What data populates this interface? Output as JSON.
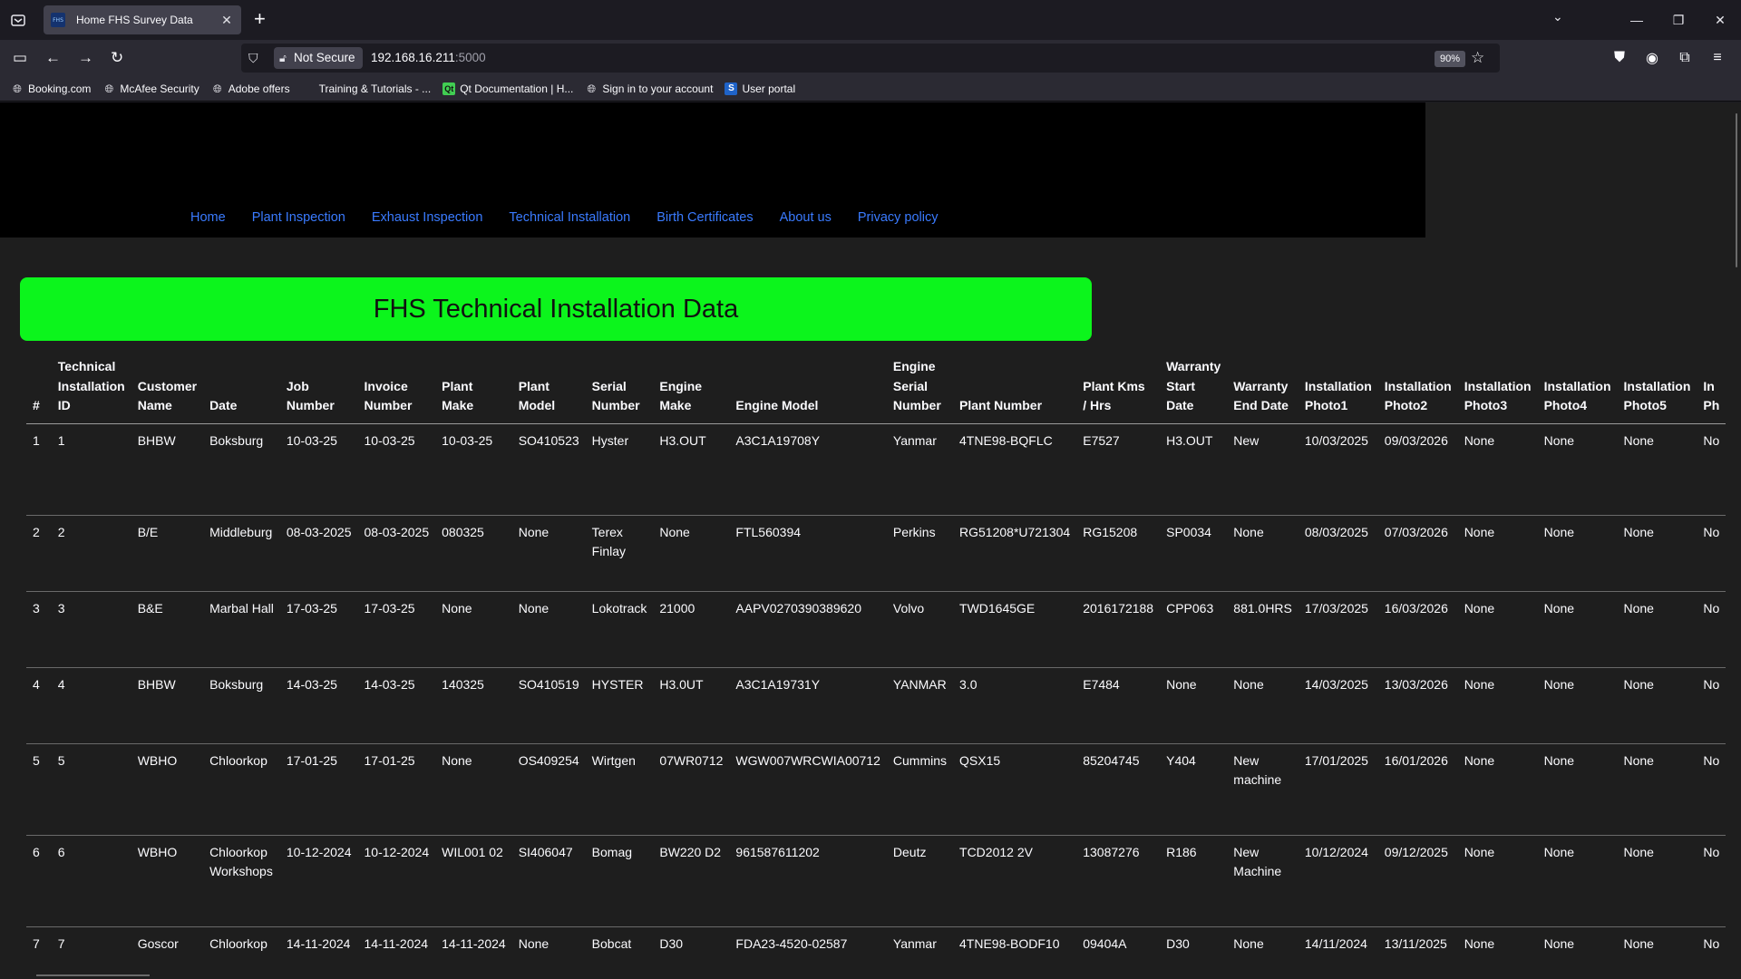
{
  "browser": {
    "tab_title": "Home FHS Survey Data",
    "favicon_text": "FHS",
    "security_label": "Not Secure",
    "url_host": "192.168.16.211",
    "url_port": ":5000",
    "zoom": "90%",
    "bookmarks": [
      {
        "label": "Booking.com",
        "icon": "globe-icon"
      },
      {
        "label": "McAfee Security",
        "icon": "globe-icon"
      },
      {
        "label": "Adobe offers",
        "icon": "globe-icon"
      },
      {
        "label": "Training & Tutorials - ...",
        "icon": "blank-icon"
      },
      {
        "label": "Qt Documentation | H...",
        "icon": "qt-icon"
      },
      {
        "label": "Sign in to your account",
        "icon": "globe-icon"
      },
      {
        "label": "User portal",
        "icon": "s-icon"
      }
    ]
  },
  "site": {
    "nav": [
      "Home",
      "Plant Inspection",
      "Exhaust Inspection",
      "Technical Installation",
      "Birth Certificates",
      "About us",
      "Privacy policy"
    ],
    "banner_title": "FHS Technical Installation Data"
  },
  "table": {
    "headers": [
      [
        "#"
      ],
      [
        "Technical",
        "Installation",
        "ID"
      ],
      [
        "Customer",
        "Name"
      ],
      [
        "Date"
      ],
      [
        "Job",
        "Number"
      ],
      [
        "Invoice",
        "Number"
      ],
      [
        "Plant",
        "Make"
      ],
      [
        "Plant",
        "Model"
      ],
      [
        "Serial",
        "Number"
      ],
      [
        "Engine",
        "Make"
      ],
      [
        "Engine Model"
      ],
      [
        "Engine",
        "Serial",
        "Number"
      ],
      [
        "Plant Number"
      ],
      [
        "Plant Kms",
        "/ Hrs"
      ],
      [
        "Warranty",
        "Start",
        "Date"
      ],
      [
        "Warranty",
        "End Date"
      ],
      [
        "Installation",
        "Photo1"
      ],
      [
        "Installation",
        "Photo2"
      ],
      [
        "Installation",
        "Photo3"
      ],
      [
        "Installation",
        "Photo4"
      ],
      [
        "Installation",
        "Photo5"
      ],
      [
        "In",
        "Ph"
      ]
    ],
    "rows": [
      [
        [
          "1"
        ],
        [
          "1"
        ],
        [
          "BHBW"
        ],
        [
          "Boksburg"
        ],
        [
          "10-03-25"
        ],
        [
          "10-03-25"
        ],
        [
          "10-03-25"
        ],
        [
          "SO410523"
        ],
        [
          "Hyster"
        ],
        [
          "H3.OUT"
        ],
        [
          "A3C1A19708Y"
        ],
        [
          "Yanmar"
        ],
        [
          "4TNE98-BQFLC"
        ],
        [
          "E7527"
        ],
        [
          "H3.OUT"
        ],
        [
          "New"
        ],
        [
          "10/03/2025"
        ],
        [
          "09/03/2026"
        ],
        [
          "None"
        ],
        [
          "None"
        ],
        [
          "None"
        ],
        [
          "No"
        ]
      ],
      [
        [
          "2"
        ],
        [
          "2"
        ],
        [
          "B/E"
        ],
        [
          "Middleburg"
        ],
        [
          "08-03-2025"
        ],
        [
          "08-03-2025"
        ],
        [
          "080325"
        ],
        [
          "None"
        ],
        [
          "Terex",
          "Finlay"
        ],
        [
          "None"
        ],
        [
          "FTL560394"
        ],
        [
          "Perkins"
        ],
        [
          "RG51208*U721304"
        ],
        [
          "RG15208"
        ],
        [
          "SP0034"
        ],
        [
          "None"
        ],
        [
          "08/03/2025"
        ],
        [
          "07/03/2026"
        ],
        [
          "None"
        ],
        [
          "None"
        ],
        [
          "None"
        ],
        [
          "No"
        ]
      ],
      [
        [
          "3"
        ],
        [
          "3"
        ],
        [
          "B&E"
        ],
        [
          "Marbal Hall"
        ],
        [
          "17-03-25"
        ],
        [
          "17-03-25"
        ],
        [
          "None"
        ],
        [
          "None"
        ],
        [
          "Lokotrack"
        ],
        [
          "21000"
        ],
        [
          "AAPV0270390389620"
        ],
        [
          "Volvo"
        ],
        [
          "TWD1645GE"
        ],
        [
          "2016172188"
        ],
        [
          "CPP063"
        ],
        [
          "881.0HRS"
        ],
        [
          "17/03/2025"
        ],
        [
          "16/03/2026"
        ],
        [
          "None"
        ],
        [
          "None"
        ],
        [
          "None"
        ],
        [
          "No"
        ]
      ],
      [
        [
          "4"
        ],
        [
          "4"
        ],
        [
          "BHBW"
        ],
        [
          "Boksburg"
        ],
        [
          "14-03-25"
        ],
        [
          "14-03-25"
        ],
        [
          "140325"
        ],
        [
          "SO410519"
        ],
        [
          "HYSTER"
        ],
        [
          "H3.0UT"
        ],
        [
          "A3C1A19731Y"
        ],
        [
          "YANMAR"
        ],
        [
          "3.0"
        ],
        [
          "E7484"
        ],
        [
          "None"
        ],
        [
          "None"
        ],
        [
          "14/03/2025"
        ],
        [
          "13/03/2026"
        ],
        [
          "None"
        ],
        [
          "None"
        ],
        [
          "None"
        ],
        [
          "No"
        ]
      ],
      [
        [
          "5"
        ],
        [
          "5"
        ],
        [
          "WBHO"
        ],
        [
          "Chloorkop"
        ],
        [
          "17-01-25"
        ],
        [
          "17-01-25"
        ],
        [
          "None"
        ],
        [
          "OS409254"
        ],
        [
          "Wirtgen"
        ],
        [
          "07WR0712"
        ],
        [
          "WGW007WRCWIA00712"
        ],
        [
          "Cummins"
        ],
        [
          "QSX15"
        ],
        [
          "85204745"
        ],
        [
          "Y404"
        ],
        [
          "New",
          "machine"
        ],
        [
          "17/01/2025"
        ],
        [
          "16/01/2026"
        ],
        [
          "None"
        ],
        [
          "None"
        ],
        [
          "None"
        ],
        [
          "No"
        ]
      ],
      [
        [
          "6"
        ],
        [
          "6"
        ],
        [
          "WBHO"
        ],
        [
          "Chloorkop",
          "Workshops"
        ],
        [
          "10-12-2024"
        ],
        [
          "10-12-2024"
        ],
        [
          "WIL001 02"
        ],
        [
          "SI406047"
        ],
        [
          "Bomag"
        ],
        [
          "BW220 D2"
        ],
        [
          "961587611202"
        ],
        [
          "Deutz"
        ],
        [
          "TCD2012 2V"
        ],
        [
          "13087276"
        ],
        [
          "R186"
        ],
        [
          "New",
          "Machine"
        ],
        [
          "10/12/2024"
        ],
        [
          "09/12/2025"
        ],
        [
          "None"
        ],
        [
          "None"
        ],
        [
          "None"
        ],
        [
          "No"
        ]
      ],
      [
        [
          "7"
        ],
        [
          "7"
        ],
        [
          "Goscor"
        ],
        [
          "Chloorkop"
        ],
        [
          "14-11-2024"
        ],
        [
          "14-11-2024"
        ],
        [
          "14-11-2024"
        ],
        [
          "None"
        ],
        [
          "Bobcat"
        ],
        [
          "D30"
        ],
        [
          "FDA23-4520-02587"
        ],
        [
          "Yanmar"
        ],
        [
          "4TNE98-BODF10"
        ],
        [
          "09404A"
        ],
        [
          "D30"
        ],
        [
          "None"
        ],
        [
          "14/11/2024"
        ],
        [
          "13/11/2025"
        ],
        [
          "None"
        ],
        [
          "None"
        ],
        [
          "None"
        ],
        [
          "No"
        ]
      ]
    ]
  }
}
